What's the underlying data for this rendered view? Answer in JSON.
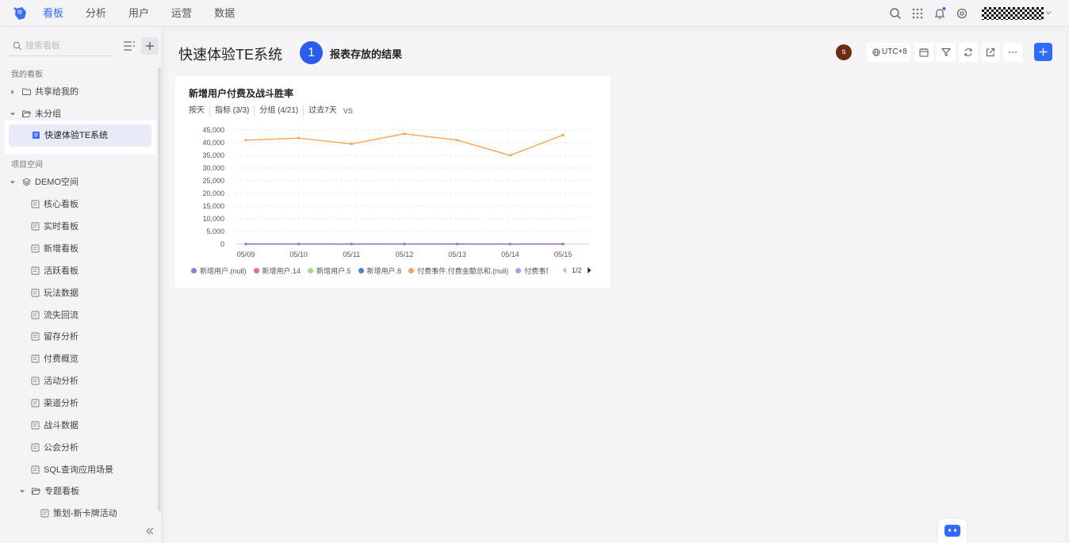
{
  "topbar": {
    "nav": [
      {
        "label": "看板",
        "active": true
      },
      {
        "label": "分析",
        "active": false
      },
      {
        "label": "用户",
        "active": false
      },
      {
        "label": "运营",
        "active": false
      },
      {
        "label": "数据",
        "active": false
      }
    ],
    "icons": [
      "search-icon",
      "apps-grid-icon",
      "bell-icon",
      "settings-icon"
    ],
    "accent": "#2f6bff"
  },
  "sidebar": {
    "search_placeholder": "搜索看板",
    "my_boards_label": "我的看板",
    "shared_folder": "共享给我的",
    "ungrouped_folder": "未分组",
    "selected_board": "快速体验TE系统",
    "project_space_label": "项目空间",
    "demo_space": "DEMO空间",
    "boards": [
      "核心看板",
      "实时看板",
      "新增看板",
      "活跃看板",
      "玩法数据",
      "流失回流",
      "留存分析",
      "付费概览",
      "活动分析",
      "渠道分析",
      "战斗数据",
      "公会分析",
      "SQL查询应用场景"
    ],
    "topic_folder": "专题看板",
    "topic_board": "策划-新卡牌活动"
  },
  "main": {
    "title": "快速体验TE系统",
    "step_number": "1",
    "step_text": "报表存放的结果",
    "user_initial": "s",
    "timezone": "UTC+8"
  },
  "card": {
    "title": "新增用户付费及战斗胜率",
    "filters": [
      "按天",
      "指标 (3/3)",
      "分组 (4/21)",
      "过去7天"
    ],
    "vs_label": "VS",
    "legend": [
      {
        "name": "新增用户.(null)",
        "color": "#9b74e0"
      },
      {
        "name": "新增用户.14",
        "color": "#f06b6b"
      },
      {
        "name": "新增用户.5",
        "color": "#a6d97a"
      },
      {
        "name": "新增用户.8",
        "color": "#4a7fe0"
      },
      {
        "name": "付费事件.付费金额总和.(null)",
        "color": "#f5a45a"
      },
      {
        "name": "付费事件.付费金额",
        "color": "#b89be6"
      }
    ],
    "pager": "1/2"
  },
  "chart_data": {
    "type": "line",
    "categories": [
      "05/09",
      "05/10",
      "05/11",
      "05/12",
      "05/13",
      "05/14",
      "05/15"
    ],
    "yticks": [
      0,
      5000,
      10000,
      15000,
      20000,
      25000,
      30000,
      35000,
      40000,
      45000
    ],
    "ytick_labels": [
      "0",
      "5,000",
      "10,000",
      "15,000",
      "20,000",
      "25,000",
      "30,000",
      "35,000",
      "40,000",
      "45,000"
    ],
    "ylim": [
      0,
      45000
    ],
    "grid": true,
    "series": [
      {
        "name": "付费事件.付费金额总和.(null)",
        "color": "#f5a45a",
        "values": [
          41000,
          41800,
          39500,
          43500,
          41000,
          35000,
          43000
        ]
      },
      {
        "name": "新增用户.(null)",
        "color": "#9b74e0",
        "values": [
          80,
          90,
          70,
          100,
          80,
          60,
          90
        ]
      },
      {
        "name": "新增用户.14",
        "color": "#f06b6b",
        "values": [
          40,
          50,
          35,
          45,
          40,
          30,
          40
        ]
      },
      {
        "name": "新增用户.5",
        "color": "#6cc49a",
        "values": [
          20,
          25,
          20,
          30,
          25,
          20,
          25
        ]
      }
    ]
  }
}
